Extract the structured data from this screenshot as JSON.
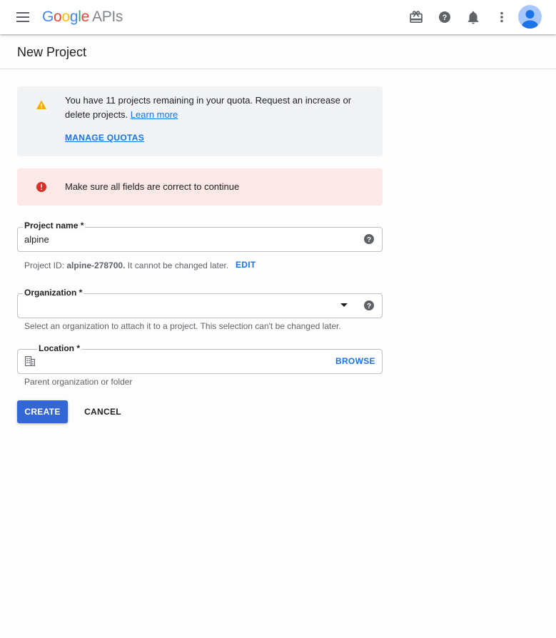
{
  "header": {
    "logo_google": [
      "G",
      "o",
      "o",
      "g",
      "l",
      "e"
    ],
    "logo_product": "APIs",
    "icons": [
      "menu-icon",
      "gift-icon",
      "help-icon",
      "notifications-icon",
      "more-vert-icon",
      "account-avatar"
    ]
  },
  "page": {
    "title": "New Project"
  },
  "quota_notice": {
    "text": "You have 11 projects remaining in your quota. Request an increase or delete projects.",
    "learn_more": "Learn more",
    "manage_quotas": "MANAGE QUOTAS"
  },
  "error_notice": {
    "text": "Make sure all fields are correct to continue"
  },
  "form": {
    "project_name": {
      "label": "Project name *",
      "value": "alpine"
    },
    "project_id": {
      "prefix": "Project ID:",
      "id": "alpine-278700.",
      "suffix": "It cannot be changed later.",
      "edit": "EDIT"
    },
    "organization": {
      "label": "Organization *",
      "value": "",
      "hint": "Select an organization to attach it to a project. This selection can't be changed later."
    },
    "location": {
      "label": "Location *",
      "browse": "BROWSE",
      "hint": "Parent organization or folder"
    }
  },
  "actions": {
    "create": "CREATE",
    "cancel": "CANCEL"
  },
  "colors": {
    "primary": "#1a73e8",
    "create_button": "#3367d6",
    "warning": "#f9ab00",
    "error": "#d93025",
    "error_bg": "#fce8e6",
    "info_bg": "#f1f3f4"
  }
}
